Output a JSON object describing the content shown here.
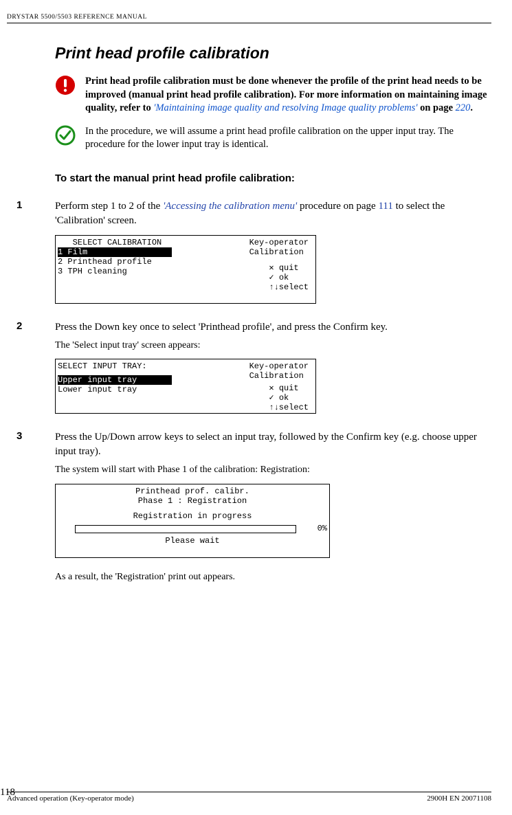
{
  "header": {
    "running": "DRYSTAR 5500/5503 REFERENCE MANUAL"
  },
  "section": {
    "title": "Print head profile calibration"
  },
  "warning": {
    "text_prefix": "Print head profile calibration must be done whenever the profile of the print head needs to be improved (manual print head profile calibration). For more information on maintaining image quality, refer to ",
    "link_text": "'Maintaining image quality and resolving Image quality problems'",
    "text_suffix": " on page ",
    "page_ref": "220",
    "period": "."
  },
  "info": {
    "text": "In the procedure, we will assume a print head profile calibration on the upper input tray. The procedure for the lower input tray is identical."
  },
  "subheading": "To start the manual print head profile calibration:",
  "step1": {
    "num": "1",
    "line1_pre": "Perform step 1 to 2 of the ",
    "link": "'Accessing the calibration menu'",
    "line1_mid": " procedure on page ",
    "pageref": "111",
    "line2": "to select the 'Calibration' screen."
  },
  "screen1": {
    "title": "   SELECT CALIBRATION",
    "opt1": "1 Film                 ",
    "opt2": "2 Printhead profile",
    "opt3": "3 TPH cleaning",
    "right1": "Key-operator",
    "right2": " Calibration",
    "act1": "✕ quit",
    "act2": "✓ ok",
    "act3": "↑↓select"
  },
  "step2": {
    "num": "2",
    "line1": "Press the Down key once to select 'Printhead profile', and press the Confirm key.",
    "line2": "The 'Select input tray' screen appears:"
  },
  "screen2": {
    "title": "SELECT INPUT TRAY:",
    "opt1": "Upper input tray       ",
    "opt2": "Lower input tray",
    "right1": "Key-operator",
    "right2": " Calibration",
    "act1": "✕ quit",
    "act2": "✓ ok",
    "act3": "↑↓select"
  },
  "step3": {
    "num": "3",
    "line1": "Press the Up/Down arrow keys to select an input tray, followed by the Confirm key (e.g. choose upper input tray).",
    "line2": "The system will start with Phase 1 of the calibration: Registration:"
  },
  "screen3": {
    "title1": "Printhead prof. calibr.",
    "title2": "Phase 1 : Registration",
    "msg": "Registration in progress",
    "pct": "0%",
    "wait": "Please wait"
  },
  "step3_result": "As a result, the 'Registration' print out appears.",
  "footer": {
    "page_num": "118",
    "left": "Advanced operation (Key-operator mode)",
    "right": "2900H EN 20071108"
  }
}
